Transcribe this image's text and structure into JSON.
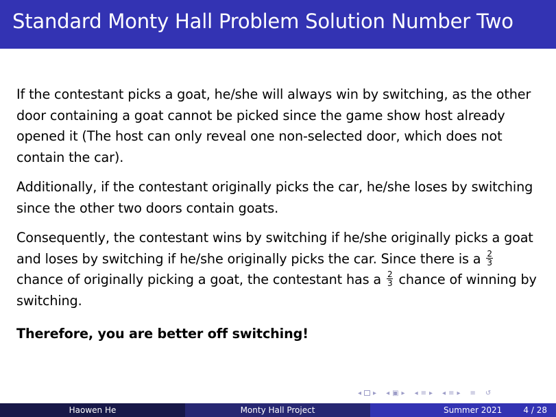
{
  "slide": {
    "title": "Standard Monty Hall Problem Solution Number Two",
    "paragraphs": {
      "p1": "If the contestant picks a goat, he/she will always win by switching, as the other door containing a goat cannot be picked since the game show host already opened it (The host can only reveal one non-selected door, which does not contain the car).",
      "p2": "Additionally, if the contestant originally picks the car, he/she loses by switching since the other two doors contain goats.",
      "p3a": "Consequently, the contestant wins by switching if he/she originally picks a goat and loses by switching if he/she originally picks the car. Since there is a",
      "p3b": "chance of originally picking a goat, the contestant has a",
      "p3c": "chance of winning by switching.",
      "p4": "Therefore, you are better off switching!"
    },
    "fraction": {
      "numerator": "2",
      "denominator": "3"
    }
  },
  "footer": {
    "author": "Haowen He",
    "project": "Monty Hall Project",
    "date": "Summer 2021",
    "page": "4 / 28"
  },
  "colors": {
    "title_bar": "#3333b3",
    "footer_dark": "#181848",
    "footer_mid": "#272772",
    "footer_light": "#3333b3",
    "nav_symbols": "#9c9cc7"
  },
  "nav_icons": [
    "frame-prev-icon",
    "frame-icon",
    "frame-next-icon",
    "section-prev-icon",
    "section-icon",
    "section-next-icon",
    "subsection-prev-icon",
    "subsection-icon",
    "subsection-next-icon",
    "align-icon",
    "search-icon"
  ]
}
